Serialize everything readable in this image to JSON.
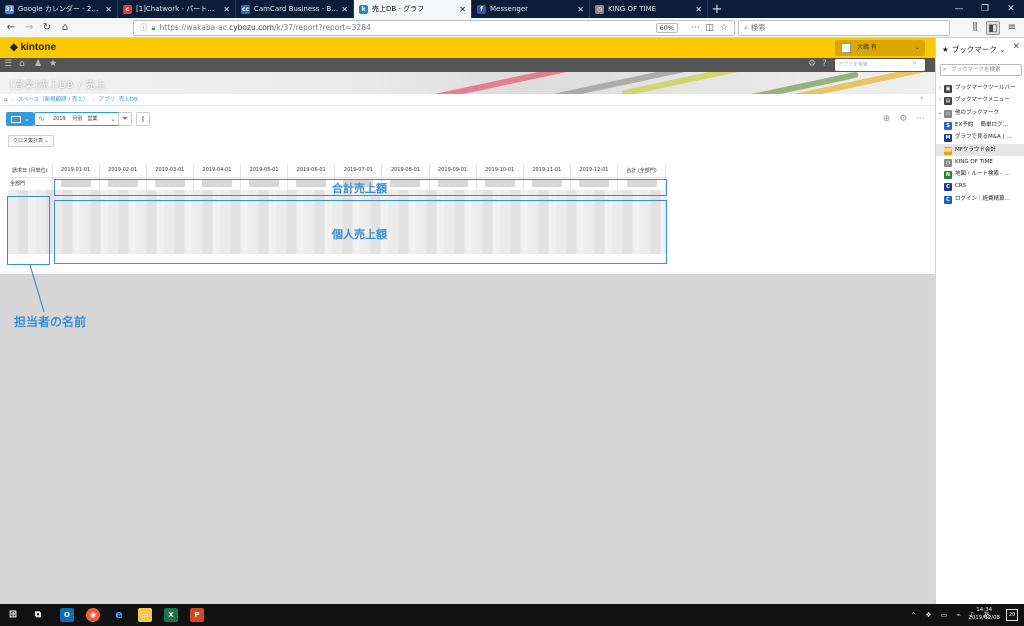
{
  "browser": {
    "tabs": [
      {
        "title": "Google カレンダー - 2019年 2月",
        "icon_color": "#4285f4",
        "icon": "31"
      },
      {
        "title": "[1]Chatwork - パートナー",
        "icon_color": "#e53935",
        "icon": "c"
      },
      {
        "title": "CamCard Business - Business C",
        "icon_color": "#2d6cb5",
        "icon": "cc"
      },
      {
        "title": "売上DB - グラフ",
        "icon_color": "#1f8ecb",
        "icon": "k",
        "active": true
      },
      {
        "title": "Messenger",
        "icon_color": "#3b5998",
        "icon": "f"
      },
      {
        "title": "KING OF TIME",
        "icon_color": "#888888",
        "icon": "◷"
      }
    ],
    "new_tab": "+",
    "url_domain": "https://wakaba-ac.",
    "url_host": "cybozu.com",
    "url_path": "/k/37/report?report=3284",
    "zoom": "60%",
    "search_placeholder": "検索"
  },
  "kintone": {
    "logo": "kintone",
    "user_name": "大嶋 有",
    "app_search_placeholder": "アプリを検索",
    "app_title": "[営業]売上DB / 売上",
    "breadcrumb": [
      "スペース（新規顧問 / 売上）",
      "アプリ: 売上DB"
    ],
    "graph_label": "2019 　月別　営業",
    "cross_button": "クロス集計表",
    "table": {
      "corner_label": "請求日 (月単位)",
      "columns": [
        "2019-01-01",
        "2019-02-01",
        "2019-03-01",
        "2019-04-01",
        "2019-05-01",
        "2019-06-01",
        "2019-07-01",
        "2019-08-01",
        "2019-09-01",
        "2019-10-01",
        "2019-11-01",
        "2019-12-01",
        "合計 (全部門)"
      ],
      "subtotal_label": "全部門"
    },
    "annotations": {
      "total_sales": "合計売上額",
      "individual_sales": "個人売上額",
      "person_name": "担当者の名前"
    }
  },
  "sidebar": {
    "title": "ブックマーク",
    "search_placeholder": "ブックマークを検索",
    "items": [
      {
        "label": "ブックマークツールバー",
        "icon_color": "#444444",
        "twisty": "›",
        "icon": "▣",
        "selected": false
      },
      {
        "label": "ブックマークメニュー",
        "icon_color": "#444444",
        "twisty": "›",
        "icon": "▤",
        "selected": false
      },
      {
        "label": "他のブックマーク",
        "icon_color": "#888888",
        "twisty": "⌄",
        "icon": "▭",
        "selected": false
      },
      {
        "label": "EX予約　 簡単ログ…",
        "icon_color": "#2b6cb0",
        "twisty": "",
        "icon": "S",
        "selected": false
      },
      {
        "label": "グラフで見るM&A | …",
        "icon_color": "#1e3a8a",
        "twisty": "",
        "icon": "M",
        "selected": false
      },
      {
        "label": "MFクラウド会計",
        "icon_color": "#f59e0b",
        "twisty": "",
        "icon": "MF",
        "selected": true
      },
      {
        "label": "KING OF TIME",
        "icon_color": "#888888",
        "twisty": "",
        "icon": "◷",
        "selected": false
      },
      {
        "label": "地図・ルート検索 - …",
        "icon_color": "#2e7d32",
        "twisty": "",
        "icon": "N",
        "selected": false
      },
      {
        "label": "CRS",
        "icon_color": "#1e3a8a",
        "twisty": "",
        "icon": "C",
        "selected": false
      },
      {
        "label": "ログイン｜経費精算…",
        "icon_color": "#1565c0",
        "twisty": "",
        "icon": "C",
        "selected": false
      }
    ]
  },
  "taskbar": {
    "clock_time": "14:34",
    "clock_date": "2019/02/08",
    "notifications": "20",
    "ime": "あ"
  }
}
